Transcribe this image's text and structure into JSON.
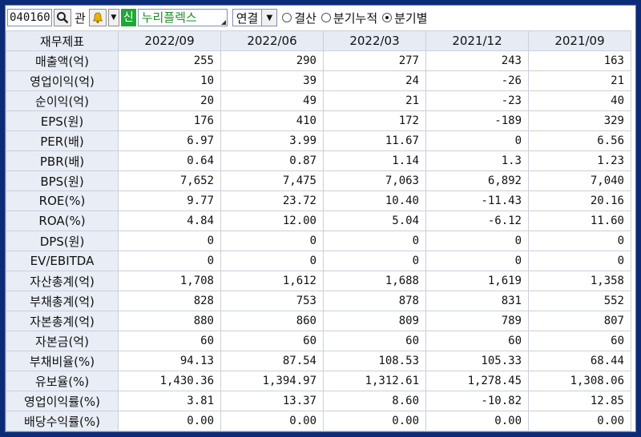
{
  "toolbar": {
    "stock_code": "040160",
    "search_icon": "magnifier-icon",
    "gwan_label": "관",
    "bell_icon": "bell-icon",
    "shin_badge": "신",
    "company_name": "누리플렉스",
    "consolidation": "연결",
    "radios": [
      {
        "label": "결산",
        "selected": false
      },
      {
        "label": "분기누적",
        "selected": false
      },
      {
        "label": "분기별",
        "selected": true
      }
    ]
  },
  "table": {
    "header_label": "재무제표",
    "periods": [
      "2022/09",
      "2022/06",
      "2022/03",
      "2021/12",
      "2021/09"
    ],
    "rows": [
      {
        "label": "매출액(억)",
        "values": [
          "255",
          "290",
          "277",
          "243",
          "163"
        ]
      },
      {
        "label": "영업이익(억)",
        "values": [
          "10",
          "39",
          "24",
          "-26",
          "21"
        ]
      },
      {
        "label": "순이익(억)",
        "values": [
          "20",
          "49",
          "21",
          "-23",
          "40"
        ]
      },
      {
        "label": "EPS(원)",
        "values": [
          "176",
          "410",
          "172",
          "-189",
          "329"
        ]
      },
      {
        "label": "PER(배)",
        "values": [
          "6.97",
          "3.99",
          "11.67",
          "0",
          "6.56"
        ]
      },
      {
        "label": "PBR(배)",
        "values": [
          "0.64",
          "0.87",
          "1.14",
          "1.3",
          "1.23"
        ]
      },
      {
        "label": "BPS(원)",
        "values": [
          "7,652",
          "7,475",
          "7,063",
          "6,892",
          "7,040"
        ]
      },
      {
        "label": "ROE(%)",
        "values": [
          "9.77",
          "23.72",
          "10.40",
          "-11.43",
          "20.16"
        ]
      },
      {
        "label": "ROA(%)",
        "values": [
          "4.84",
          "12.00",
          "5.04",
          "-6.12",
          "11.60"
        ]
      },
      {
        "label": "DPS(원)",
        "values": [
          "0",
          "0",
          "0",
          "0",
          "0"
        ]
      },
      {
        "label": "EV/EBITDA",
        "values": [
          "0",
          "0",
          "0",
          "0",
          "0"
        ]
      },
      {
        "label": "자산총계(억)",
        "values": [
          "1,708",
          "1,612",
          "1,688",
          "1,619",
          "1,358"
        ]
      },
      {
        "label": "부채총계(억)",
        "values": [
          "828",
          "753",
          "878",
          "831",
          "552"
        ]
      },
      {
        "label": "자본총계(억)",
        "values": [
          "880",
          "860",
          "809",
          "789",
          "807"
        ]
      },
      {
        "label": "자본금(억)",
        "values": [
          "60",
          "60",
          "60",
          "60",
          "60"
        ]
      },
      {
        "label": "부채비율(%)",
        "values": [
          "94.13",
          "87.54",
          "108.53",
          "105.33",
          "68.44"
        ]
      },
      {
        "label": "유보율(%)",
        "values": [
          "1,430.36",
          "1,394.97",
          "1,312.61",
          "1,278.45",
          "1,308.06"
        ]
      },
      {
        "label": "영업이익률(%)",
        "values": [
          "3.81",
          "13.37",
          "8.60",
          "-10.82",
          "12.85"
        ]
      },
      {
        "label": "배당수익률(%)",
        "values": [
          "0.00",
          "0.00",
          "0.00",
          "0.00",
          "0.00"
        ]
      }
    ]
  }
}
